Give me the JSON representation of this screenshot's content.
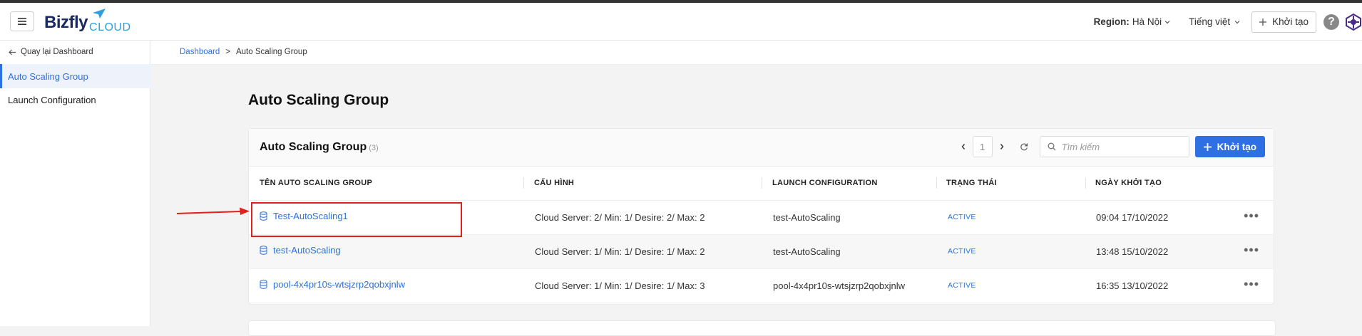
{
  "header": {
    "logo_main": "Bizfly",
    "logo_sub": "CLOUD",
    "region_label": "Region:",
    "region_value": "Hà Nội",
    "language": "Tiếng việt",
    "create_label": "Khởi tạo",
    "help": "?"
  },
  "sidebar": {
    "back_label": "Quay lại Dashboard",
    "items": [
      {
        "label": "Auto Scaling Group",
        "active": true
      },
      {
        "label": "Launch Configuration",
        "active": false
      }
    ]
  },
  "breadcrumb": {
    "home": "Dashboard",
    "separator": ">",
    "current": "Auto Scaling Group"
  },
  "page": {
    "title": "Auto Scaling Group"
  },
  "card": {
    "title": "Auto Scaling Group",
    "count": "(3)",
    "page_number": "1",
    "search_placeholder": "Tìm kiếm",
    "create_label": "Khởi tạo"
  },
  "table": {
    "columns": [
      "TÊN AUTO SCALING GROUP",
      "CẤU HÌNH",
      "LAUNCH CONFIGURATION",
      "TRẠNG THÁI",
      "NGÀY KHỞI TẠO"
    ],
    "rows": [
      {
        "name": "Test-AutoScaling1",
        "config": "Cloud Server: 2/ Min: 1/ Desire: 2/ Max: 2",
        "launch": "test-AutoScaling",
        "status": "ACTIVE",
        "date": "09:04 17/10/2022",
        "actions": "•••"
      },
      {
        "name": "test-AutoScaling",
        "config": "Cloud Server: 1/ Min: 1/ Desire: 1/ Max: 2",
        "launch": "test-AutoScaling",
        "status": "ACTIVE",
        "date": "13:48 15/10/2022",
        "actions": "•••"
      },
      {
        "name": "pool-4x4pr10s-wtsjzrp2qobxjnlw",
        "config": "Cloud Server: 1/ Min: 1/ Desire: 1/ Max: 3",
        "launch": "pool-4x4pr10s-wtsjzrp2qobxjnlw",
        "status": "ACTIVE",
        "date": "16:35 13/10/2022",
        "actions": "•••"
      }
    ]
  },
  "colors": {
    "accent": "#2f6fe4",
    "annotation": "#e0201c",
    "brand_dark": "#1c2a63",
    "brand_light": "#2c9fe0"
  },
  "icons": [
    "menu-icon",
    "plane-icon",
    "chevron-down-icon",
    "plus-icon",
    "help-icon",
    "settings-hex-icon",
    "arrow-left-icon",
    "chevron-left-icon",
    "chevron-right-icon",
    "refresh-icon",
    "search-icon",
    "database-icon",
    "more-icon"
  ]
}
